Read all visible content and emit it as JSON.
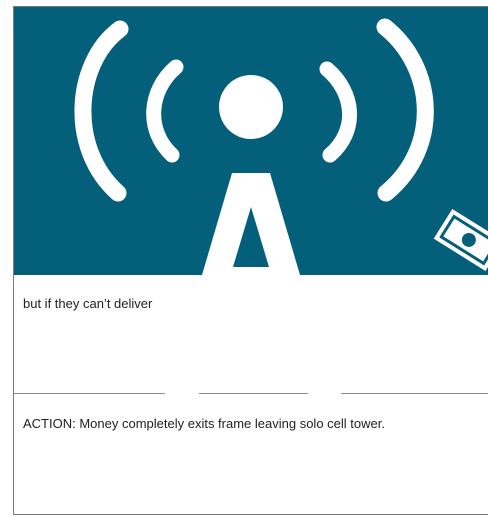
{
  "storyboard": {
    "caption": "but if they can’t deliver",
    "action_note": "ACTION: Money completely exits frame leaving solo cell tower."
  },
  "colors": {
    "panel_background": "#04607a",
    "illustration": "#ffffff",
    "text": "#222222",
    "rule": "#8a8a8a"
  },
  "icons": {
    "main_illustration": "cell-tower-icon",
    "exiting_object": "money-bill-icon"
  }
}
